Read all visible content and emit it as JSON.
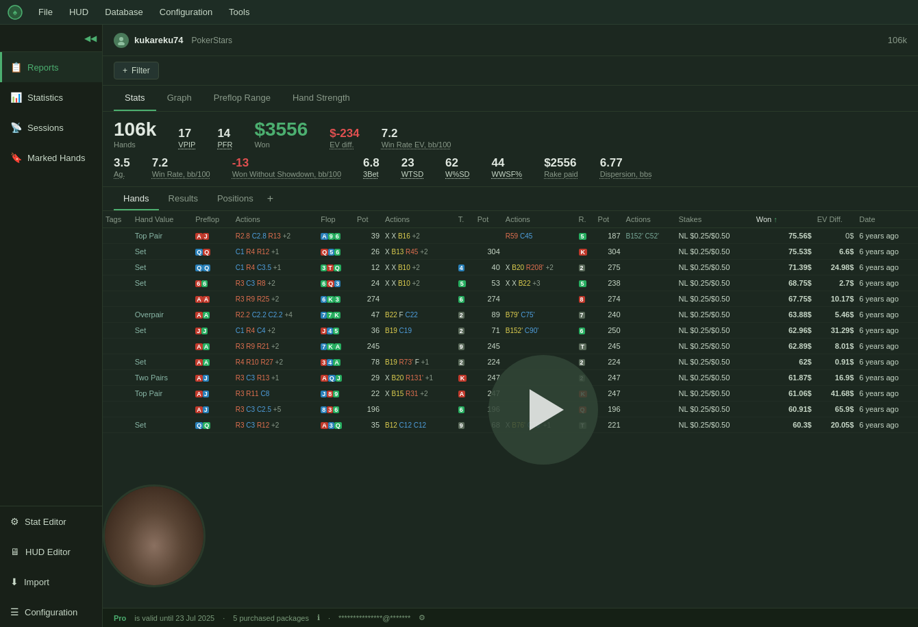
{
  "menuBar": {
    "logo": "♠",
    "items": [
      "File",
      "HUD",
      "Database",
      "Configuration",
      "Tools"
    ]
  },
  "sidebar": {
    "collapseIcon": "◀◀",
    "items": [
      {
        "id": "reports",
        "label": "Reports",
        "icon": "📋",
        "active": true
      },
      {
        "id": "statistics",
        "label": "Statistics",
        "icon": "📊",
        "active": false
      },
      {
        "id": "sessions",
        "label": "Sessions",
        "icon": "📡",
        "active": false
      },
      {
        "id": "marked-hands",
        "label": "Marked Hands",
        "icon": "🔖",
        "active": false
      }
    ],
    "bottomItems": [
      {
        "id": "stat-editor",
        "label": "Stat Editor",
        "icon": "⚙"
      },
      {
        "id": "hud-editor",
        "label": "HUD Editor",
        "icon": "🖥"
      },
      {
        "id": "import",
        "label": "Import",
        "icon": "⬇"
      },
      {
        "id": "configuration",
        "label": "Configuration",
        "icon": "☰"
      }
    ]
  },
  "playerHeader": {
    "playerName": "kukareku74",
    "site": "PokerStars",
    "handCount": "106k"
  },
  "filter": {
    "label": "Filter"
  },
  "tabs": [
    {
      "id": "stats",
      "label": "Stats",
      "active": true
    },
    {
      "id": "graph",
      "label": "Graph",
      "active": false
    },
    {
      "id": "preflop-range",
      "label": "Preflop Range",
      "active": false
    },
    {
      "id": "hand-strength",
      "label": "Hand Strength",
      "active": false
    }
  ],
  "statsOverview": {
    "hands": "106k",
    "handsLabel": "Hands",
    "vpip": "17",
    "vpipLabel": "VPIP",
    "pfr": "14",
    "pfrLabel": "PFR",
    "won": "$3556",
    "wonLabel": "Won",
    "wonClass": "green",
    "evDiff": "$-234",
    "evDiffLabel": "EV diff.",
    "evDiffClass": "red",
    "winRateEV": "7.2",
    "winRateEVLabel": "Win Rate EV, bb/100",
    "ag": "3.5",
    "agLabel": "Ag.",
    "winRate": "7.2",
    "winRateLabel": "Win Rate, bb/100",
    "wonWithout": "-13",
    "wonWithoutLabel": "Won Without Showdown, bb/100",
    "threeBet": "6.8",
    "threeBetLabel": "3Bet",
    "wtsd": "23",
    "wtsdLabel": "WTSD",
    "wsd": "62",
    "wsdLabel": "W%SD",
    "wwsf": "44",
    "wwsfLabel": "WWSF%",
    "rakePaid": "$2556",
    "rakePaidLabel": "Rake paid",
    "dispersion": "6.77",
    "dispersionLabel": "Dispersion, bbs"
  },
  "handsTabs": [
    {
      "id": "hands",
      "label": "Hands",
      "active": true
    },
    {
      "id": "results",
      "label": "Results",
      "active": false
    },
    {
      "id": "positions",
      "label": "Positions",
      "active": false
    }
  ],
  "tableHeaders": [
    "Tags",
    "Hand Value",
    "Preflop",
    "Actions",
    "Flop",
    "Pot",
    "Actions",
    "T.",
    "Pot",
    "Actions",
    "R.",
    "Pot",
    "Actions",
    "Stakes",
    "Won ↑",
    "EV Diff.",
    "Date"
  ],
  "tableRows": [
    {
      "tags": "",
      "handValue": "Top Pair",
      "preflop": "AJ",
      "preflopCards": [
        {
          "val": "A",
          "suit": "r"
        },
        {
          "val": "J",
          "suit": "r"
        }
      ],
      "preflopActions": "R2.8 C2.8 R13 +2",
      "flop": "A 9 6",
      "flopCards": [
        {
          "val": "A",
          "color": "b"
        },
        {
          "val": "9",
          "color": "g"
        },
        {
          "val": "6",
          "color": "g"
        }
      ],
      "flopPot": "39",
      "flopActions": "X X B16 +2",
      "turn": "",
      "turnPot": "",
      "turnActions": "R59 C45",
      "river": "5",
      "riverPot": "187",
      "riverActions": "B152' C52'",
      "stakes": "NL $0.25/$0.50",
      "won": "75.56$",
      "wonClass": "pos",
      "evDiff": "0$",
      "evDiffClass": "zero",
      "date": "6 years ago"
    },
    {
      "tags": "",
      "handValue": "Set",
      "preflop": "QQ",
      "preflopCards": [
        {
          "val": "Q",
          "suit": "b"
        },
        {
          "val": "Q",
          "suit": "r"
        }
      ],
      "preflopActions": "C1 R4 R12 +1",
      "flop": "Q 5 6",
      "flopCards": [
        {
          "val": "Q",
          "color": "r"
        },
        {
          "val": "5",
          "color": "b"
        },
        {
          "val": "6",
          "color": "g"
        }
      ],
      "flopPot": "26",
      "flopActions": "X B13 R45 +2",
      "turn": "",
      "turnPot": "304",
      "turnActions": "",
      "river": "K",
      "riverPot": "304",
      "riverActions": "",
      "stakes": "NL $0.25/$0.50",
      "won": "75.53$",
      "wonClass": "pos",
      "evDiff": "6.6$",
      "evDiffClass": "pos",
      "date": "6 years ago"
    },
    {
      "tags": "",
      "handValue": "Set",
      "preflop": "QQ",
      "preflopCards": [
        {
          "val": "Q",
          "suit": "b"
        },
        {
          "val": "Q",
          "suit": "b"
        }
      ],
      "preflopActions": "C1 R4 C3.5 +1",
      "flop": "3 T Q",
      "flopCards": [
        {
          "val": "3",
          "color": "g"
        },
        {
          "val": "T",
          "color": "r"
        },
        {
          "val": "Q",
          "color": "g"
        }
      ],
      "flopPot": "12",
      "flopActions": "X X B10 +2",
      "turn": "4",
      "turnPot": "40",
      "turnActions": "X B20 R208' +2",
      "river": "2",
      "riverPot": "275",
      "riverActions": "",
      "stakes": "NL $0.25/$0.50",
      "won": "71.39$",
      "wonClass": "pos",
      "evDiff": "24.98$",
      "evDiffClass": "pos",
      "date": "6 years ago"
    },
    {
      "tags": "",
      "handValue": "Set",
      "preflop": "66",
      "preflopCards": [
        {
          "val": "6",
          "suit": "r"
        },
        {
          "val": "6",
          "suit": "g"
        }
      ],
      "preflopActions": "R3 C3 R8 +2",
      "flop": "6 Q 3",
      "flopCards": [
        {
          "val": "6",
          "color": "g"
        },
        {
          "val": "Q",
          "color": "r"
        },
        {
          "val": "3",
          "color": "b"
        }
      ],
      "flopPot": "24",
      "flopActions": "X X B10 +2",
      "turn": "5",
      "turnPot": "53",
      "turnActions": "X X B22 +3",
      "river": "5",
      "riverPot": "238",
      "riverActions": "",
      "stakes": "NL $0.25/$0.50",
      "won": "68.75$",
      "wonClass": "pos",
      "evDiff": "2.7$",
      "evDiffClass": "pos",
      "date": "6 years ago"
    },
    {
      "tags": "",
      "handValue": "",
      "preflop": "AA",
      "preflopCards": [
        {
          "val": "A",
          "suit": "r"
        },
        {
          "val": "A",
          "suit": "r"
        }
      ],
      "preflopActions": "R3 R9 R25 +2",
      "flop": "6 K 3",
      "flopCards": [
        {
          "val": "6",
          "color": "b"
        },
        {
          "val": "K",
          "color": "g"
        },
        {
          "val": "3",
          "color": "g"
        }
      ],
      "flopPot": "274",
      "flopActions": "",
      "turn": "6",
      "turnPot": "274",
      "turnActions": "",
      "river": "8",
      "riverPot": "274",
      "riverActions": "",
      "stakes": "NL $0.25/$0.50",
      "won": "67.75$",
      "wonClass": "pos",
      "evDiff": "10.17$",
      "evDiffClass": "pos",
      "date": "6 years ago"
    },
    {
      "tags": "",
      "handValue": "Overpair",
      "preflop": "AA",
      "preflopCards": [
        {
          "val": "A",
          "suit": "r"
        },
        {
          "val": "A",
          "suit": "g"
        }
      ],
      "preflopActions": "R2.2 C2.2 C2.2 +4",
      "flop": "7 7 K",
      "flopCards": [
        {
          "val": "7",
          "color": "b"
        },
        {
          "val": "7",
          "color": "g"
        },
        {
          "val": "K",
          "color": "g"
        }
      ],
      "flopPot": "47",
      "flopActions": "B22 F C22",
      "turn": "2",
      "turnPot": "89",
      "turnActions": "B79' C75'",
      "river": "7",
      "riverPot": "240",
      "riverActions": "",
      "stakes": "NL $0.25/$0.50",
      "won": "63.88$",
      "wonClass": "pos",
      "evDiff": "5.46$",
      "evDiffClass": "pos",
      "date": "6 years ago"
    },
    {
      "tags": "",
      "handValue": "Set",
      "preflop": "JJ",
      "preflopCards": [
        {
          "val": "J",
          "suit": "r"
        },
        {
          "val": "J",
          "suit": "g"
        }
      ],
      "preflopActions": "C1 R4 C4 +2",
      "flop": "J 4 5",
      "flopCards": [
        {
          "val": "J",
          "color": "r"
        },
        {
          "val": "4",
          "color": "b"
        },
        {
          "val": "5",
          "color": "g"
        }
      ],
      "flopPot": "36",
      "flopActions": "B19 C19",
      "turn": "2",
      "turnPot": "71",
      "turnActions": "B152' C90'",
      "river": "6",
      "riverPot": "250",
      "riverActions": "",
      "stakes": "NL $0.25/$0.50",
      "won": "62.96$",
      "wonClass": "pos",
      "evDiff": "31.29$",
      "evDiffClass": "pos",
      "date": "6 years ago"
    },
    {
      "tags": "",
      "handValue": "",
      "preflop": "AA",
      "preflopCards": [
        {
          "val": "A",
          "suit": "r"
        },
        {
          "val": "A",
          "suit": "g"
        }
      ],
      "preflopActions": "R3 R9 R21 +2",
      "flop": "7 K A",
      "flopCards": [
        {
          "val": "7",
          "color": "b"
        },
        {
          "val": "K",
          "color": "g"
        },
        {
          "val": "A",
          "color": "g"
        }
      ],
      "flopPot": "245",
      "flopActions": "",
      "turn": "9",
      "turnPot": "245",
      "turnActions": "",
      "river": "T",
      "riverPot": "245",
      "riverActions": "",
      "stakes": "NL $0.25/$0.50",
      "won": "62.89$",
      "wonClass": "pos",
      "evDiff": "8.01$",
      "evDiffClass": "pos",
      "date": "6 years ago"
    },
    {
      "tags": "",
      "handValue": "Set",
      "preflop": "AA",
      "preflopCards": [
        {
          "val": "A",
          "suit": "r"
        },
        {
          "val": "A",
          "suit": "g"
        }
      ],
      "preflopActions": "R4 R10 R27 +2",
      "flop": "3 4 A",
      "flopCards": [
        {
          "val": "3",
          "color": "r"
        },
        {
          "val": "4",
          "color": "b"
        },
        {
          "val": "A",
          "color": "g"
        }
      ],
      "flopPot": "78",
      "flopActions": "B19 R73' F +1",
      "turn": "2",
      "turnPot": "224",
      "turnActions": "",
      "river": "2",
      "riverPot": "224",
      "riverActions": "",
      "stakes": "NL $0.25/$0.50",
      "won": "62$",
      "wonClass": "pos",
      "evDiff": "0.91$",
      "evDiffClass": "pos",
      "date": "6 years ago"
    },
    {
      "tags": "",
      "handValue": "Two Pairs",
      "preflop": "AJ",
      "preflopCards": [
        {
          "val": "A",
          "suit": "r"
        },
        {
          "val": "J",
          "suit": "b"
        }
      ],
      "preflopActions": "R3 C3 R13 +1",
      "flop": "A Q J",
      "flopCards": [
        {
          "val": "A",
          "color": "r"
        },
        {
          "val": "Q",
          "color": "b"
        },
        {
          "val": "J",
          "color": "g"
        }
      ],
      "flopPot": "29",
      "flopActions": "X B20 R131' +1",
      "turn": "K",
      "turnPot": "247",
      "turnActions": "",
      "river": "2",
      "riverPot": "247",
      "riverActions": "",
      "stakes": "NL $0.25/$0.50",
      "won": "61.87$",
      "wonClass": "pos",
      "evDiff": "16.9$",
      "evDiffClass": "pos",
      "date": "6 years ago"
    },
    {
      "tags": "",
      "handValue": "Top Pair",
      "preflop": "AJ",
      "preflopCards": [
        {
          "val": "A",
          "suit": "r"
        },
        {
          "val": "J",
          "suit": "b"
        }
      ],
      "preflopActions": "R3 R11 C8",
      "flop": "J 8 9",
      "flopCards": [
        {
          "val": "J",
          "color": "b"
        },
        {
          "val": "8",
          "color": "r"
        },
        {
          "val": "9",
          "color": "g"
        }
      ],
      "flopPot": "22",
      "flopActions": "X B15 R31 +2",
      "turn": "A",
      "turnPot": "247",
      "turnActions": "",
      "river": "K",
      "riverPot": "247",
      "riverActions": "",
      "stakes": "NL $0.25/$0.50",
      "won": "61.06$",
      "wonClass": "pos",
      "evDiff": "41.68$",
      "evDiffClass": "pos",
      "date": "6 years ago"
    },
    {
      "tags": "",
      "handValue": "",
      "preflop": "AJ",
      "preflopCards": [
        {
          "val": "A",
          "suit": "r"
        },
        {
          "val": "J",
          "suit": "b"
        }
      ],
      "preflopActions": "R3 C3 C2.5 +5",
      "flop": "8 3 6",
      "flopCards": [
        {
          "val": "8",
          "color": "b"
        },
        {
          "val": "3",
          "color": "r"
        },
        {
          "val": "6",
          "color": "g"
        }
      ],
      "flopPot": "196",
      "flopActions": "",
      "turn": "6",
      "turnPot": "196",
      "turnActions": "",
      "river": "Q",
      "riverPot": "196",
      "riverActions": "",
      "stakes": "NL $0.25/$0.50",
      "won": "60.91$",
      "wonClass": "pos",
      "evDiff": "65.9$",
      "evDiffClass": "pos",
      "date": "6 years ago"
    },
    {
      "tags": "",
      "handValue": "Set",
      "preflop": "QQ",
      "preflopCards": [
        {
          "val": "Q",
          "suit": "b"
        },
        {
          "val": "Q",
          "suit": "g"
        }
      ],
      "preflopActions": "R3 C3 R12 +2",
      "flop": "A 3 Q",
      "flopCards": [
        {
          "val": "A",
          "color": "r"
        },
        {
          "val": "3",
          "color": "b"
        },
        {
          "val": "Q",
          "color": "g"
        }
      ],
      "flopPot": "35",
      "flopActions": "B12 C12 C12",
      "turn": "9",
      "turnPot": "68",
      "turnActions": "X B76' C76' +1",
      "river": "T",
      "riverPot": "221",
      "riverActions": "",
      "stakes": "NL $0.25/$0.50",
      "won": "60.3$",
      "wonClass": "pos",
      "evDiff": "20.05$",
      "evDiffClass": "pos",
      "date": "6 years ago"
    }
  ],
  "statusBar": {
    "proLabel": "Pro",
    "proText": "is valid until 23 Jul 2025",
    "packages": "5 purchased packages",
    "email": "***************@*******",
    "settingsIcon": "⚙"
  }
}
